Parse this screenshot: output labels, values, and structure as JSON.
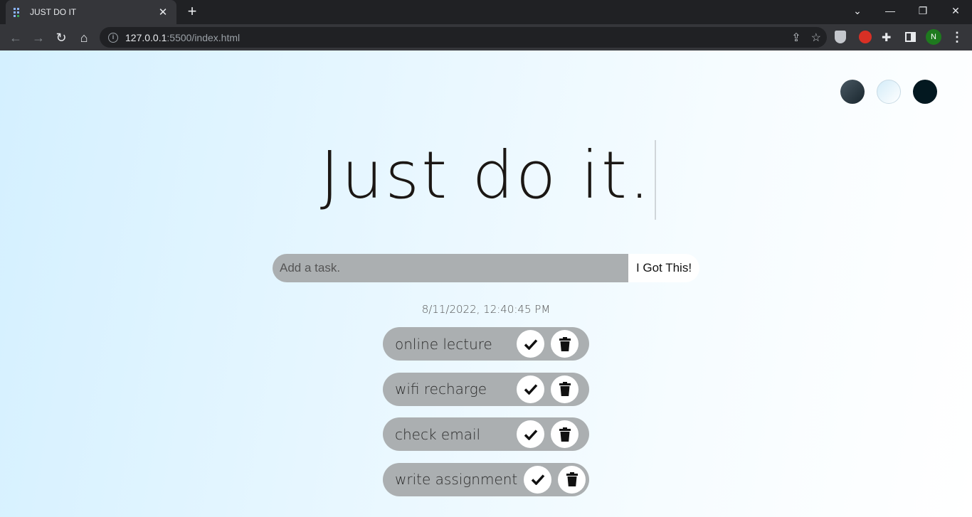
{
  "browser": {
    "tab_title": "JUST DO IT",
    "tab_close": "✕",
    "new_tab": "+",
    "url_host": "127.0.0.1",
    "url_rest": ":5500/index.html",
    "profile_initial": "N",
    "window_controls": {
      "dropdown": "⌄",
      "minimize": "—",
      "restore": "❐",
      "close": "✕"
    }
  },
  "page": {
    "theme_buttons": [
      "standard-theme",
      "light-theme",
      "darker-theme"
    ],
    "title": "Just do it.",
    "input_placeholder": "Add a task.",
    "submit_label": "I Got This!",
    "datetime": "8/11/2022, 12:40:45 PM",
    "todos": [
      {
        "text": "online lecture"
      },
      {
        "text": "wifi recharge"
      },
      {
        "text": "check email"
      },
      {
        "text": "write assignment"
      }
    ]
  },
  "colors": {
    "item_bg": "#abafb1",
    "title_color": "#1b1714",
    "theme_dark": "#031820"
  }
}
